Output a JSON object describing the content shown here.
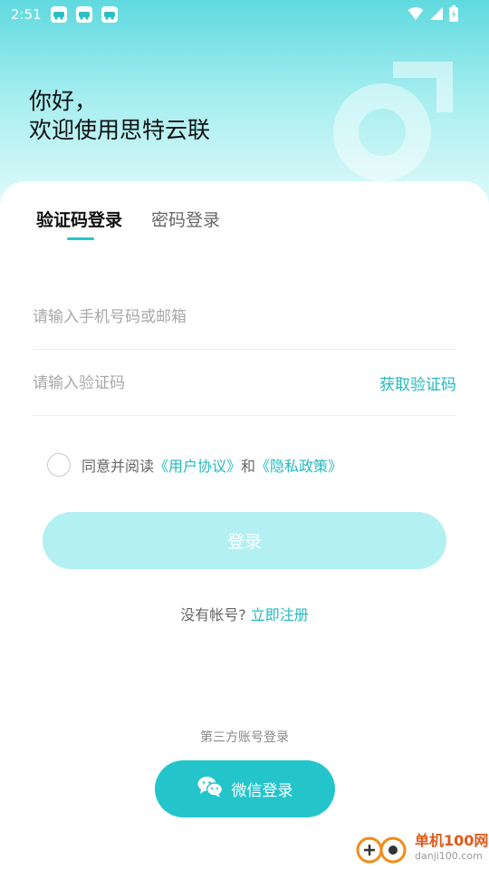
{
  "status_bar": {
    "time": "2:51"
  },
  "hero": {
    "greeting_line1": "你好，",
    "greeting_line2": "欢迎使用思特云联"
  },
  "tabs": [
    {
      "label": "验证码登录",
      "active": true
    },
    {
      "label": "密码登录",
      "active": false
    }
  ],
  "form": {
    "phone_placeholder": "请输入手机号码或邮箱",
    "code_placeholder": "请输入验证码",
    "get_code_label": "获取验证码"
  },
  "agreement": {
    "prefix": "同意并阅读",
    "user_agreement": "《用户协议》",
    "and": "和",
    "privacy_policy": "《隐私政策》"
  },
  "login_button_label": "登录",
  "register": {
    "prompt": "没有帐号?",
    "link": "立即注册"
  },
  "third_party": {
    "title": "第三方账号登录",
    "wechat_label": "微信登录"
  },
  "watermark": {
    "title": "单机100网",
    "url": "danji100.com"
  },
  "colors": {
    "accent": "#22c7cc",
    "button_disabled": "#b2f0f2",
    "wechat_button": "#23c5cb"
  }
}
